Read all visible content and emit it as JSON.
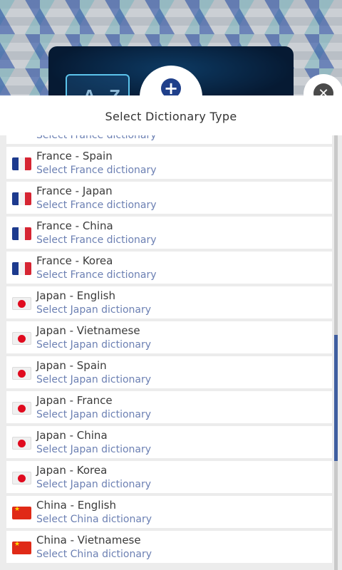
{
  "header": {
    "title": "Select Dictionary Type"
  },
  "logo": {
    "text": "A Z"
  },
  "buttons": {
    "add_icon": "plus-circle-icon",
    "close_icon": "close-circle-icon",
    "add_glyph": "+",
    "close_glyph": "✕"
  },
  "list": {
    "items": [
      {
        "flag": "fr",
        "title": "",
        "subtitle": "Select France dictionary"
      },
      {
        "flag": "fr",
        "title": "France - Spain",
        "subtitle": "Select France dictionary"
      },
      {
        "flag": "fr",
        "title": "France - Japan",
        "subtitle": "Select France dictionary"
      },
      {
        "flag": "fr",
        "title": "France - China",
        "subtitle": "Select France dictionary"
      },
      {
        "flag": "fr",
        "title": "France - Korea",
        "subtitle": "Select France dictionary"
      },
      {
        "flag": "jp",
        "title": "Japan - English",
        "subtitle": "Select Japan dictionary"
      },
      {
        "flag": "jp",
        "title": "Japan - Vietnamese",
        "subtitle": "Select Japan dictionary"
      },
      {
        "flag": "jp",
        "title": "Japan - Spain",
        "subtitle": "Select Japan dictionary"
      },
      {
        "flag": "jp",
        "title": "Japan - France",
        "subtitle": "Select Japan dictionary"
      },
      {
        "flag": "jp",
        "title": "Japan - China",
        "subtitle": "Select Japan dictionary"
      },
      {
        "flag": "jp",
        "title": "Japan - Korea",
        "subtitle": "Select Japan dictionary"
      },
      {
        "flag": "cn",
        "title": "China - English",
        "subtitle": "Select China dictionary"
      },
      {
        "flag": "cn",
        "title": "China - Vietnamese",
        "subtitle": "Select China dictionary"
      }
    ]
  },
  "colors": {
    "accent": "#1f3f8a",
    "subtitle": "#6c80b3",
    "scroll_thumb": "#3f5ea0"
  }
}
